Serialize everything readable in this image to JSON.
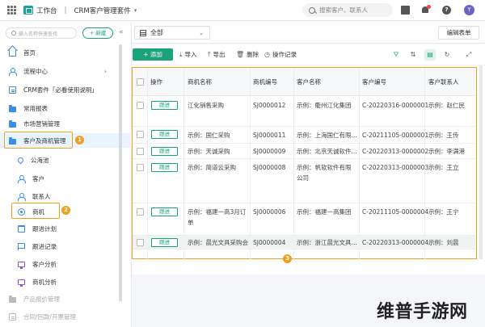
{
  "topbar": {
    "app_name": "工作台",
    "separator": "|",
    "suite_name": "CRM客户管理套件",
    "caret": "▾",
    "search_placeholder": "搜索客户、联系人",
    "avatar_letter": "Y"
  },
  "sidebar": {
    "search_placeholder": "输入名称快速查找",
    "new_label": "+ 新建",
    "collapse": "«",
    "items": [
      {
        "label": "首页"
      },
      {
        "label": "流程中心",
        "arrow": "›"
      },
      {
        "label": "CRM套件「必看使用说明」"
      },
      {
        "label": "常用报表"
      },
      {
        "label": "市场营销管理"
      },
      {
        "label": "客户及商机管理"
      },
      {
        "label": "公海池"
      },
      {
        "label": "客户"
      },
      {
        "label": "联系人"
      },
      {
        "label": "商机"
      },
      {
        "label": "跟进计划"
      },
      {
        "label": "跟进记录"
      },
      {
        "label": "客户分析"
      },
      {
        "label": "商机分析"
      },
      {
        "label": "产品报价管理"
      },
      {
        "label": "合同/回款/开票管理"
      }
    ],
    "badge1": "1",
    "badge2": "2"
  },
  "viewbar": {
    "view_name": "全部",
    "caret": "⌄",
    "edit_form": "编辑表单"
  },
  "toolbar": {
    "add": "+ 添加",
    "import": "导入",
    "export": "导出",
    "delete": "删除",
    "log": "操作记录"
  },
  "table": {
    "headers": [
      "操作",
      "商机名称",
      "商机编号",
      "客户名称",
      "客户编号",
      "客户联系人"
    ],
    "follow_label": "跟进",
    "rows": [
      {
        "name": "江化销售采购",
        "code": "SJ0000012",
        "customer": "示例：衢州江化集团",
        "cust_code": "C-20220316-0000001",
        "contact": "示例：赵仁民"
      },
      {
        "name": "示例：国仁采购",
        "code": "SJ0000011",
        "customer": "示例：上海国仁有限...",
        "cust_code": "C-20211105-0000001",
        "contact": "示例：王传"
      },
      {
        "name": "示例：天诚采购",
        "code": "SJ0000009",
        "customer": "示例：北京天诚软件...",
        "cust_code": "C-20220313-0000002",
        "contact": "示例：李满港"
      },
      {
        "name": "示例：简道云采购",
        "code": "SJ0000008",
        "customer": "示例：帆软软件有限公司",
        "cust_code": "C-20220313-0000003",
        "contact": "示例：王立"
      },
      {
        "name": "示例：福建一高3月订单",
        "code": "SJ0000006",
        "customer": "示例：福建一高集团",
        "cust_code": "C-20211105-0000004",
        "contact": "示例：王宁"
      },
      {
        "name": "示例：晨光文具采购会...",
        "code": "SJ0000004",
        "customer": "示例：浙江晨光文具...",
        "cust_code": "C-20220313-0000004",
        "contact": "示例：刘晨"
      }
    ],
    "badge3": "3"
  },
  "watermark": "维普手游网"
}
